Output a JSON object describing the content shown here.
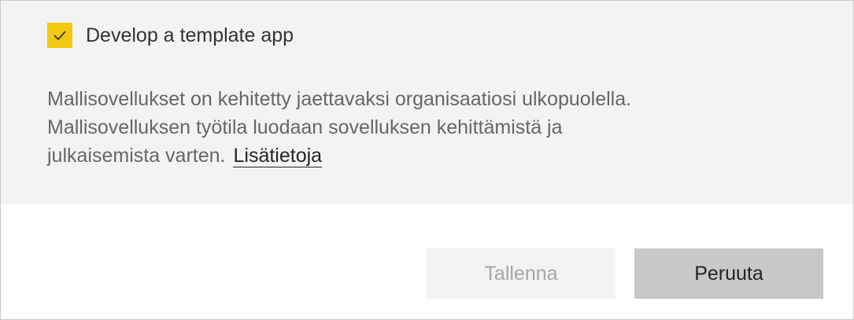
{
  "template_app": {
    "checkbox_checked": true,
    "checkbox_label": "Develop a template app",
    "accent_color": "#f2c811",
    "description_lines": [
      "Mallisovellukset on kehitetty jaettavaksi organisaatiosi ulkopuolella.",
      "Mallisovelluksen työtila luodaan sovelluksen kehittämistä ja",
      "julkaisemista varten."
    ],
    "learn_more_link": "Lisätietoja"
  },
  "footer": {
    "save_label": "Tallenna",
    "save_disabled": true,
    "cancel_label": "Peruuta"
  }
}
